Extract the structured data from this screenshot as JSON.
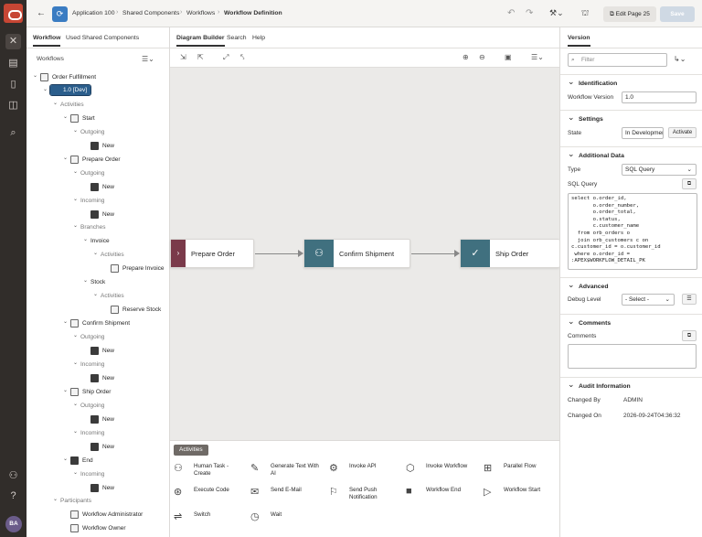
{
  "topbar": {
    "app_name": "Application 100",
    "crumb2": "Shared Components",
    "crumb3": "Workflows",
    "crumb4": "Workflow Definition",
    "edit_page_label": "Edit Page 25",
    "save_label": "Save"
  },
  "left": {
    "tabs": [
      "Workflow",
      "Used Shared Components"
    ],
    "workflows_label": "Workflows",
    "tree": [
      {
        "label": "Order Fulfillment",
        "indent": 1
      },
      {
        "label": "1.0 [Dev]",
        "indent": 2
      },
      {
        "label": "Activities",
        "indent": 3
      },
      {
        "label": "Start",
        "indent": 4
      },
      {
        "label": "Outgoing",
        "indent": 5
      },
      {
        "label": "New",
        "indent": 6
      },
      {
        "label": "Prepare Order",
        "indent": 4
      },
      {
        "label": "Outgoing",
        "indent": 5
      },
      {
        "label": "New",
        "indent": 6
      },
      {
        "label": "Incoming",
        "indent": 5
      },
      {
        "label": "New",
        "indent": 6
      },
      {
        "label": "Branches",
        "indent": 5
      },
      {
        "label": "Invoice",
        "indent": 6
      },
      {
        "label": "Activities",
        "indent": 7
      },
      {
        "label": "Prepare Invoice",
        "indent": 8
      },
      {
        "label": "Stock",
        "indent": 6
      },
      {
        "label": "Activities",
        "indent": 7
      },
      {
        "label": "Reserve Stock",
        "indent": 8
      },
      {
        "label": "Confirm Shipment",
        "indent": 4
      },
      {
        "label": "Outgoing",
        "indent": 5
      },
      {
        "label": "New",
        "indent": 6
      },
      {
        "label": "Incoming",
        "indent": 5
      },
      {
        "label": "New",
        "indent": 6
      },
      {
        "label": "Ship Order",
        "indent": 4
      },
      {
        "label": "Outgoing",
        "indent": 5
      },
      {
        "label": "New",
        "indent": 6
      },
      {
        "label": "Incoming",
        "indent": 5
      },
      {
        "label": "New",
        "indent": 6
      },
      {
        "label": "End",
        "indent": 4
      },
      {
        "label": "Incoming",
        "indent": 5
      },
      {
        "label": "New",
        "indent": 6
      },
      {
        "label": "Participants",
        "indent": 3
      },
      {
        "label": "Workflow Administrator",
        "indent": 4
      },
      {
        "label": "Workflow Owner",
        "indent": 4
      }
    ]
  },
  "center": {
    "tabs": [
      "Diagram Builder",
      "Search",
      "Help"
    ],
    "nodes": [
      "Prepare Order",
      "Confirm Shipment",
      "Ship Order"
    ],
    "palette_title": "Activities",
    "palette": [
      [
        "Human Task -\nCreate",
        "Generate Text With\nAI",
        "Invoke API",
        "Invoke Workflow",
        "Parallel Flow"
      ],
      [
        "Execute Code",
        "Send E-Mail",
        "Send Push\nNotification",
        "Workflow End",
        "Workflow Start"
      ],
      [
        "Switch",
        "Wait"
      ]
    ]
  },
  "right": {
    "tab": "Version",
    "filter_placeholder": "Filter",
    "identification": "Identification",
    "workflow_version_label": "Workflow Version",
    "workflow_version": "1.0",
    "settings": "Settings",
    "state_label": "State",
    "state_value": "In Development",
    "activate_label": "Activate",
    "additional_data": "Additional Data",
    "type_label": "Type",
    "type_value": "SQL Query",
    "sql_label": "SQL Query",
    "sql": "select o.order_id,\n       o.order_number,\n       o.order_total,\n       o.status,\n       c.customer_name\n  from orb_orders o\n  join orb_customers c on\nc.customer_id = o.customer_id\n where o.order_id =\n:APEX$WORKFLOW_DETAIL_PK",
    "advanced": "Advanced",
    "debug_label": "Debug Level",
    "debug_value": "- Select -",
    "comments_section": "Comments",
    "comments_label": "Comments",
    "audit": "Audit Information",
    "changed_by_label": "Changed By",
    "changed_by": "ADMIN",
    "changed_on_label": "Changed On",
    "changed_on": "2026-09-24T04:36:32"
  }
}
